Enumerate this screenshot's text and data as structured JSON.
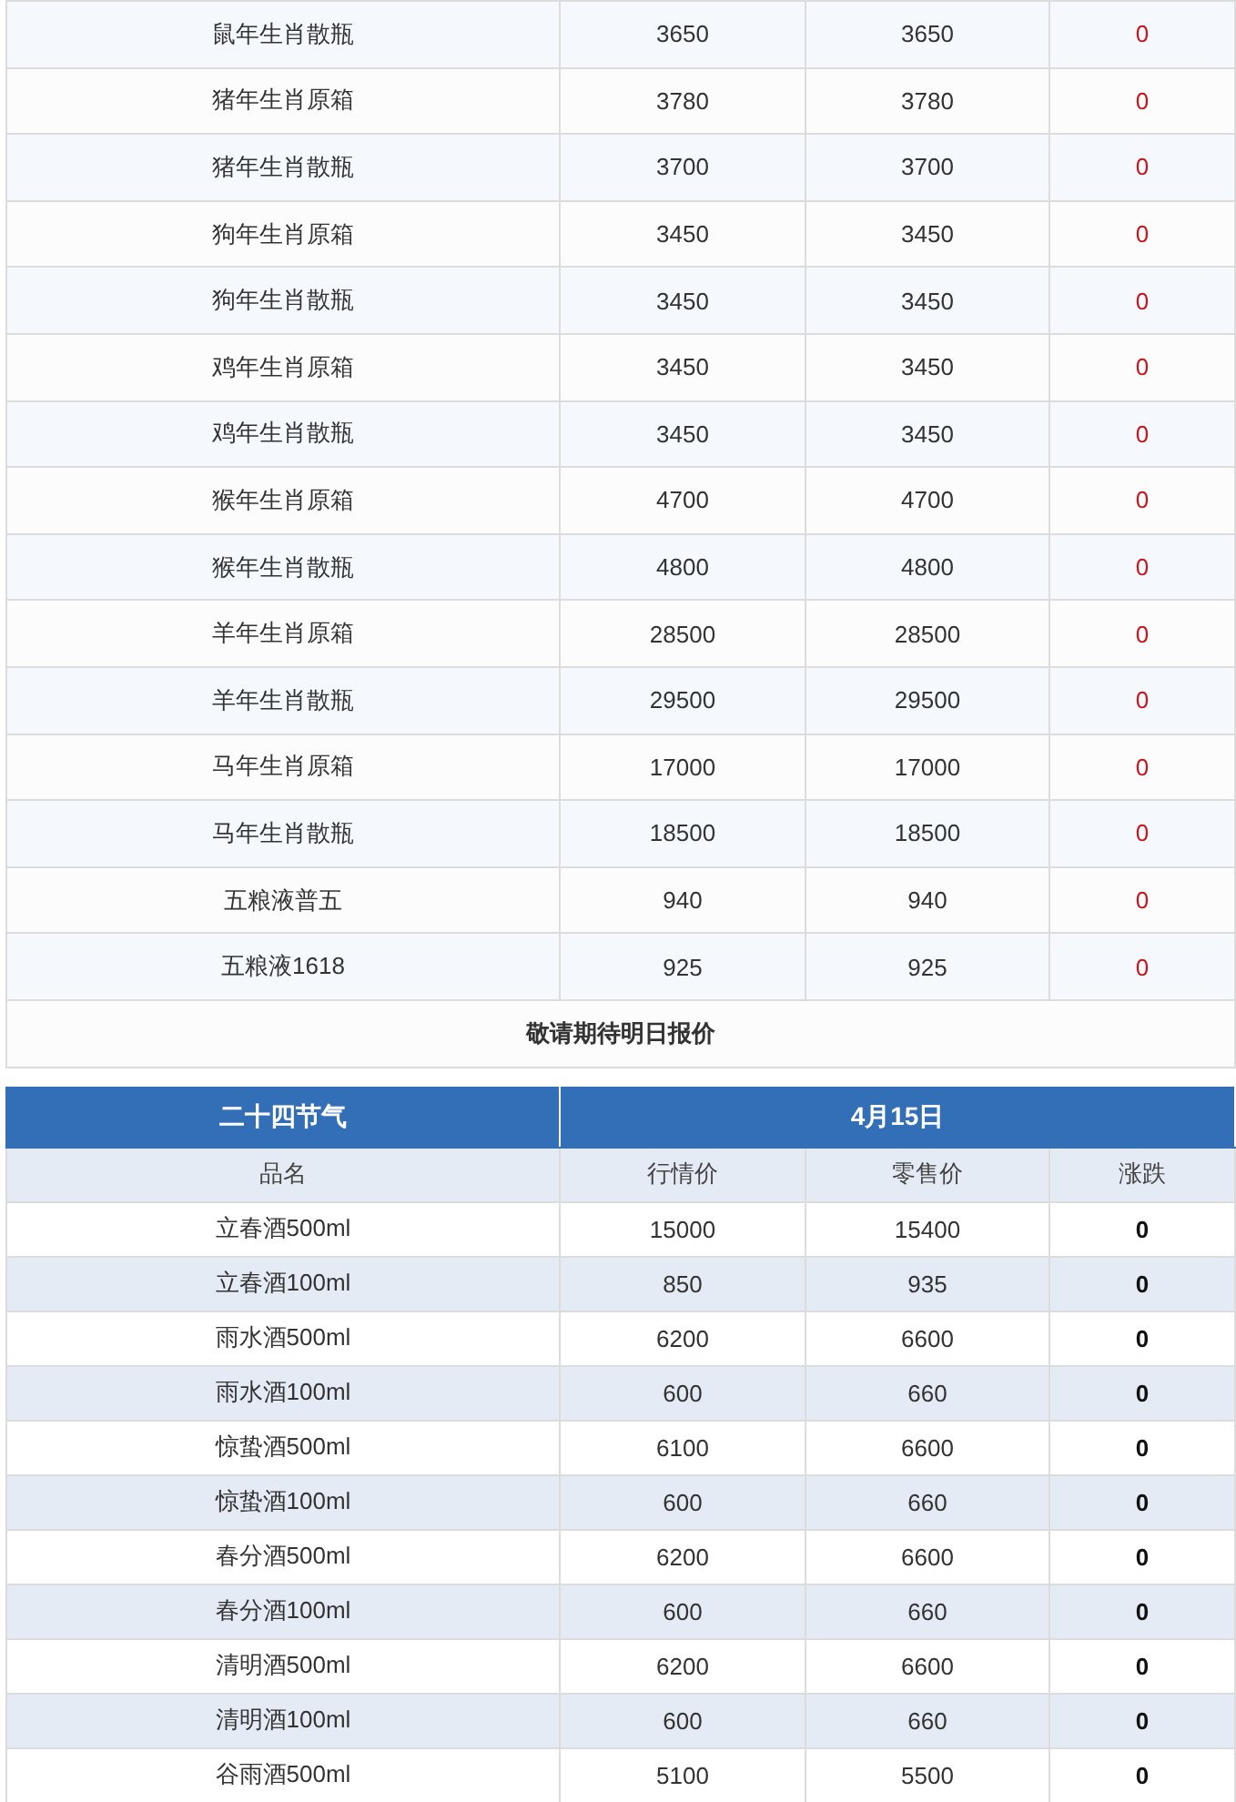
{
  "price_table": {
    "rows": [
      {
        "name": "鼠年生肖散瓶",
        "market_price": "3650",
        "retail_price": "3650",
        "change": "0"
      },
      {
        "name": "猪年生肖原箱",
        "market_price": "3780",
        "retail_price": "3780",
        "change": "0"
      },
      {
        "name": "猪年生肖散瓶",
        "market_price": "3700",
        "retail_price": "3700",
        "change": "0"
      },
      {
        "name": "狗年生肖原箱",
        "market_price": "3450",
        "retail_price": "3450",
        "change": "0"
      },
      {
        "name": "狗年生肖散瓶",
        "market_price": "3450",
        "retail_price": "3450",
        "change": "0"
      },
      {
        "name": "鸡年生肖原箱",
        "market_price": "3450",
        "retail_price": "3450",
        "change": "0"
      },
      {
        "name": "鸡年生肖散瓶",
        "market_price": "3450",
        "retail_price": "3450",
        "change": "0"
      },
      {
        "name": "猴年生肖原箱",
        "market_price": "4700",
        "retail_price": "4700",
        "change": "0"
      },
      {
        "name": "猴年生肖散瓶",
        "market_price": "4800",
        "retail_price": "4800",
        "change": "0"
      },
      {
        "name": "羊年生肖原箱",
        "market_price": "28500",
        "retail_price": "28500",
        "change": "0"
      },
      {
        "name": "羊年生肖散瓶",
        "market_price": "29500",
        "retail_price": "29500",
        "change": "0"
      },
      {
        "name": "马年生肖原箱",
        "market_price": "17000",
        "retail_price": "17000",
        "change": "0"
      },
      {
        "name": "马年生肖散瓶",
        "market_price": "18500",
        "retail_price": "18500",
        "change": "0"
      },
      {
        "name": "五粮液普五",
        "market_price": "940",
        "retail_price": "940",
        "change": "0"
      },
      {
        "name": "五粮液1618",
        "market_price": "925",
        "retail_price": "925",
        "change": "0"
      }
    ],
    "footer_note": "敬请期待明日报价"
  },
  "solar_terms_table": {
    "title": "二十四节气",
    "date": "4月15日",
    "columns": [
      "品名",
      "行情价",
      "零售价",
      "涨跌"
    ],
    "rows": [
      {
        "name": "立春酒500ml",
        "market_price": "15000",
        "retail_price": "15400",
        "change": "0"
      },
      {
        "name": "立春酒100ml",
        "market_price": "850",
        "retail_price": "935",
        "change": "0"
      },
      {
        "name": "雨水酒500ml",
        "market_price": "6200",
        "retail_price": "6600",
        "change": "0"
      },
      {
        "name": "雨水酒100ml",
        "market_price": "600",
        "retail_price": "660",
        "change": "0"
      },
      {
        "name": "惊蛰酒500ml",
        "market_price": "6100",
        "retail_price": "6600",
        "change": "0"
      },
      {
        "name": "惊蛰酒100ml",
        "market_price": "600",
        "retail_price": "660",
        "change": "0"
      },
      {
        "name": "春分酒500ml",
        "market_price": "6200",
        "retail_price": "6600",
        "change": "0"
      },
      {
        "name": "春分酒100ml",
        "market_price": "600",
        "retail_price": "660",
        "change": "0"
      },
      {
        "name": "清明酒500ml",
        "market_price": "6200",
        "retail_price": "6600",
        "change": "0"
      },
      {
        "name": "清明酒100ml",
        "market_price": "600",
        "retail_price": "660",
        "change": "0"
      },
      {
        "name": "谷雨酒500ml",
        "market_price": "5100",
        "retail_price": "5500",
        "change": "0"
      }
    ]
  }
}
